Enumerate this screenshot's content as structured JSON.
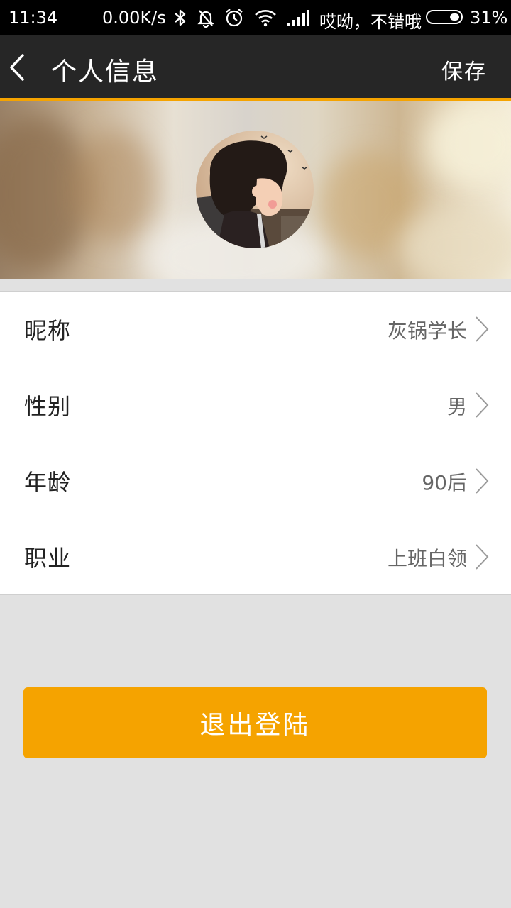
{
  "status_bar": {
    "time": "11:34",
    "net_speed": "0.00K/s",
    "carrier": "哎呦，不错哦",
    "battery": "31%",
    "battery_level": 0.31,
    "icons": [
      "bluetooth-icon",
      "bell-off-icon",
      "alarm-icon",
      "wifi-icon",
      "signal-icon",
      "battery-icon"
    ]
  },
  "app_bar": {
    "title": "个人信息",
    "save_label": "保存",
    "back_icon": "chevron-left-icon"
  },
  "profile": {
    "avatar_icon": "avatar"
  },
  "info_rows": [
    {
      "label": "昵称",
      "value": "灰锅学长"
    },
    {
      "label": "性别",
      "value": "男"
    },
    {
      "label": "年龄",
      "value": "90后"
    },
    {
      "label": "职业",
      "value": "上班白领"
    }
  ],
  "logout_label": "退出登陆",
  "colors": {
    "accent": "#f5a300",
    "app_bar_bg": "#262626",
    "page_bg": "#e1e1e1"
  }
}
